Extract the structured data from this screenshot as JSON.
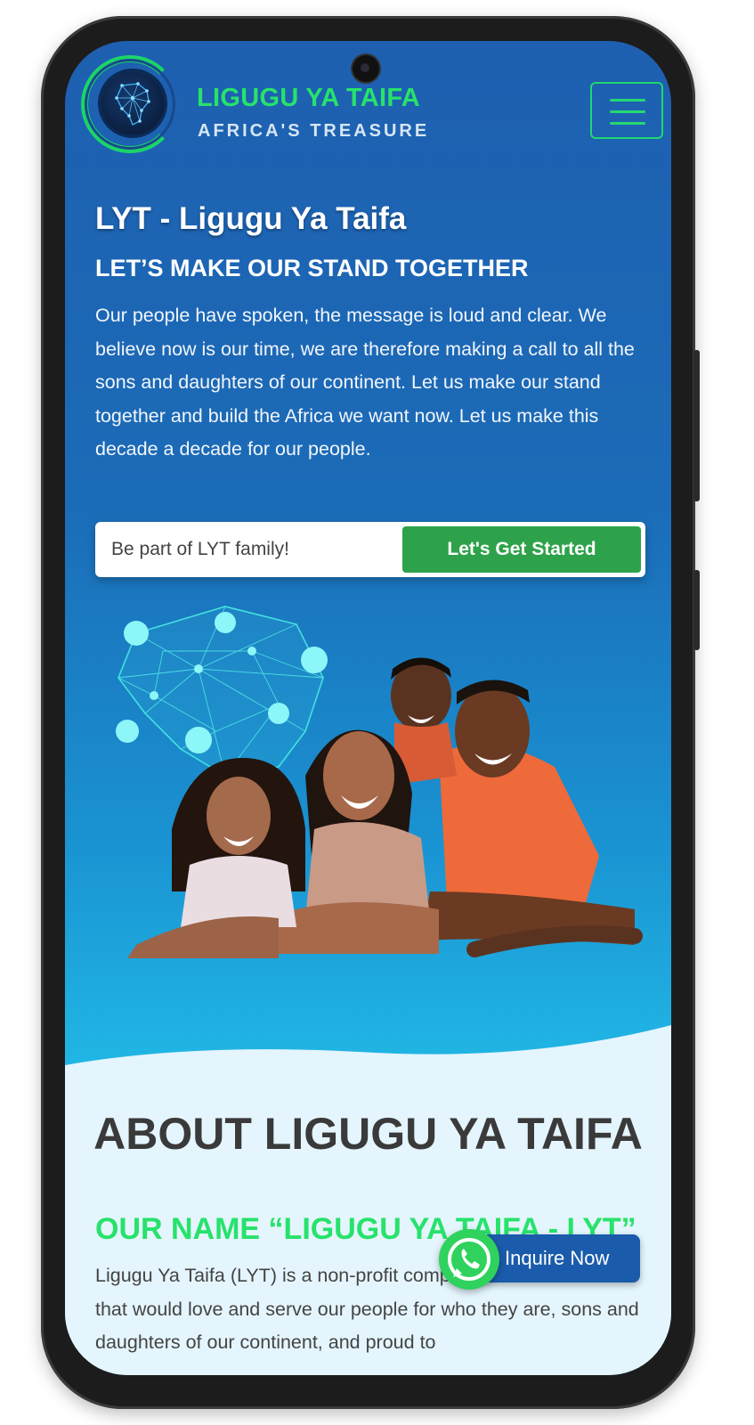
{
  "header": {
    "brand_name": "LIGUGU YA TAIFA",
    "brand_tagline": "AFRICA'S TREASURE",
    "menu_icon": "hamburger-menu-icon",
    "logo_icon": "africa-network-globe-icon"
  },
  "hero": {
    "title": "LYT - Ligugu Ya Taifa",
    "subtitle": "LET’S MAKE OUR STAND TOGETHER",
    "body": "Our people have spoken, the message is loud and clear. We believe now is our time, we are therefore making a call to all the sons and daughters of our continent. Let us make our stand together and build the Africa we want now. Let us make this decade a decade for our people.",
    "cta_placeholder": "Be part of LYT family!",
    "cta_button": "Let's Get Started"
  },
  "about": {
    "title": "ABOUT LIGUGU YA TAIFA",
    "subtitle": "OUR NAME “LIGUGU YA TAIFA - LYT”",
    "body": "Ligugu Ya Taifa (LYT) is a non-profit company ... to start a bank that would love and serve our people for who they are, sons and daughters of our continent, and proud to"
  },
  "floating": {
    "inquire_label": "Inquire Now",
    "whatsapp_icon": "whatsapp-icon"
  },
  "colors": {
    "brand_green": "#27e26b",
    "hero_blue": "#1e5fb0",
    "cta_green": "#2ea24a",
    "inquire_blue": "#1a5cab",
    "about_bg": "#e4f5fd"
  }
}
